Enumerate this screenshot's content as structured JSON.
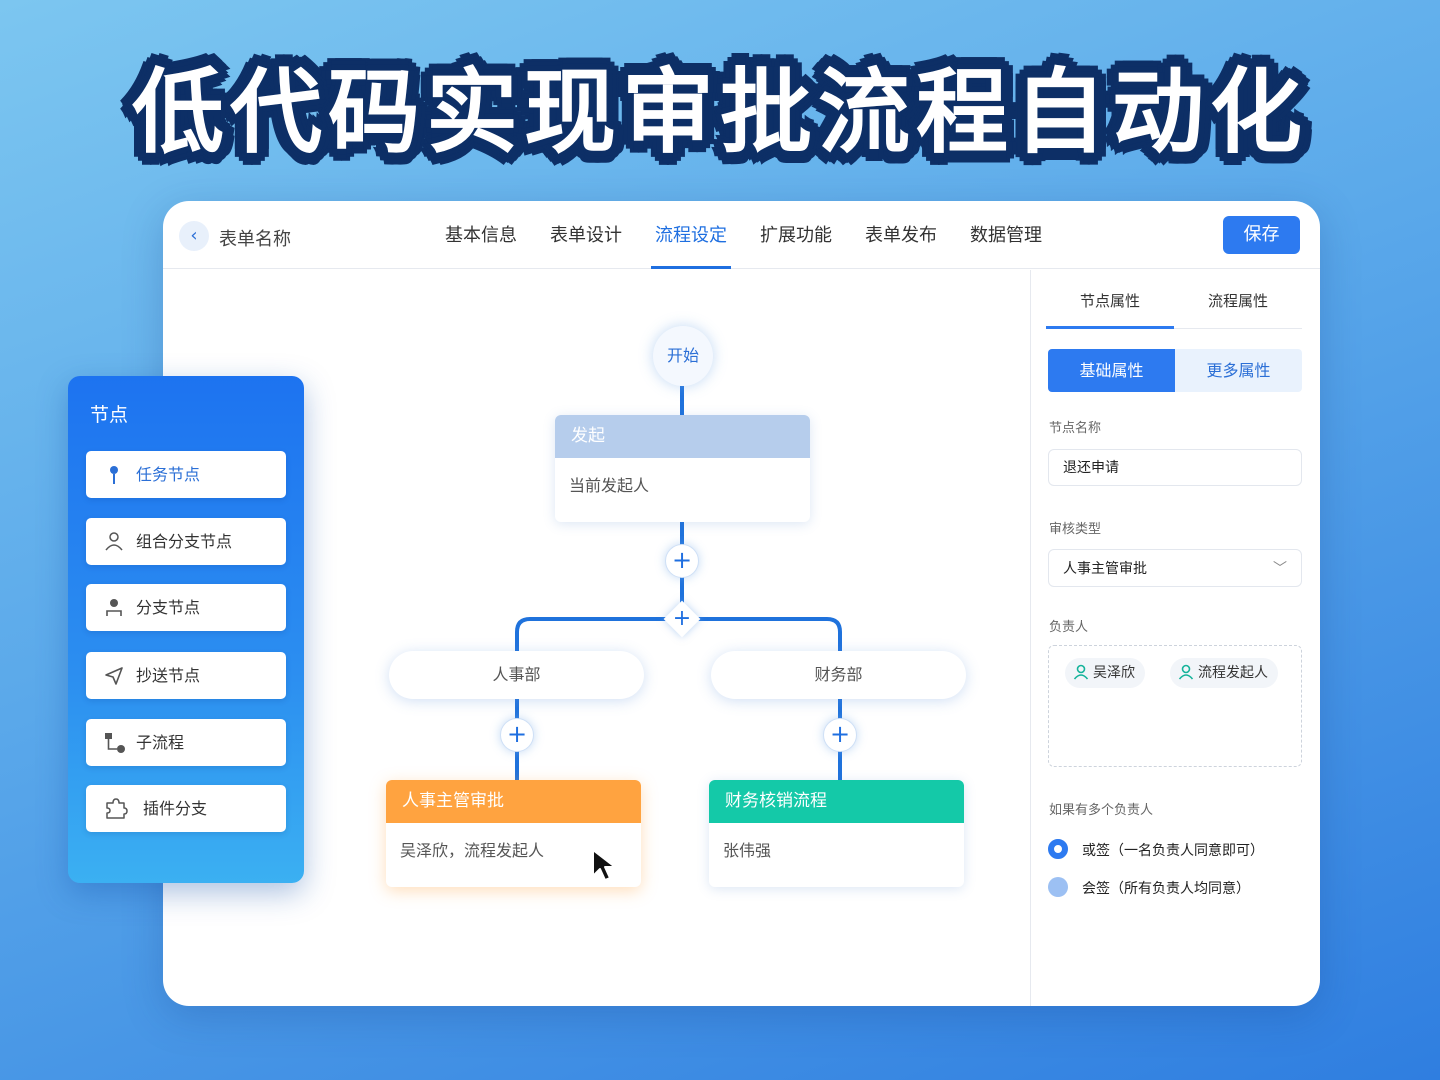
{
  "headline": "低代码实现审批流程自动化",
  "header": {
    "form_name": "表单名称",
    "tabs": [
      {
        "label": "基本信息"
      },
      {
        "label": "表单设计"
      },
      {
        "label": "流程设定"
      },
      {
        "label": "扩展功能"
      },
      {
        "label": "表单发布"
      },
      {
        "label": "数据管理"
      }
    ],
    "active_tab": "流程设定",
    "save_label": "保存"
  },
  "flow": {
    "start_label": "开始",
    "initiate": {
      "title": "发起",
      "body": "当前发起人"
    },
    "branches": [
      {
        "label": "人事部",
        "node_title": "人事主管审批",
        "node_body": "吴泽欣，流程发起人"
      },
      {
        "label": "财务部",
        "node_title": "财务核销流程",
        "node_body": "张伟强"
      }
    ],
    "plus_symbol": "+"
  },
  "palette": {
    "title": "节点",
    "items": [
      {
        "label": "任务节点",
        "icon": "pin-icon"
      },
      {
        "label": "组合分支节点",
        "icon": "user-group-icon"
      },
      {
        "label": "分支节点",
        "icon": "branch-user-icon"
      },
      {
        "label": "抄送节点",
        "icon": "send-icon"
      },
      {
        "label": "子流程",
        "icon": "subprocess-icon"
      },
      {
        "label": "插件分支",
        "icon": "puzzle-icon"
      }
    ]
  },
  "panel": {
    "tabs": [
      {
        "label": "节点属性"
      },
      {
        "label": "流程属性"
      }
    ],
    "segments": [
      {
        "label": "基础属性"
      },
      {
        "label": "更多属性"
      }
    ],
    "node_name_label": "节点名称",
    "node_name_value": "退还申请",
    "audit_type_label": "审核类型",
    "audit_type_value": "人事主管审批",
    "owner_label": "负责人",
    "owners": [
      "吴泽欣",
      "流程发起人"
    ],
    "multi_owner_label": "如果有多个负责人",
    "options": [
      {
        "label": "或签（一名负责人同意即可）",
        "selected": true
      },
      {
        "label": "会签（所有负责人均同意）",
        "selected": false
      }
    ]
  },
  "colors": {
    "accent": "#2d7af0",
    "hr_node": "#ffa340",
    "finance_node": "#14c9a8",
    "initiate_node": "#b6cdec"
  }
}
